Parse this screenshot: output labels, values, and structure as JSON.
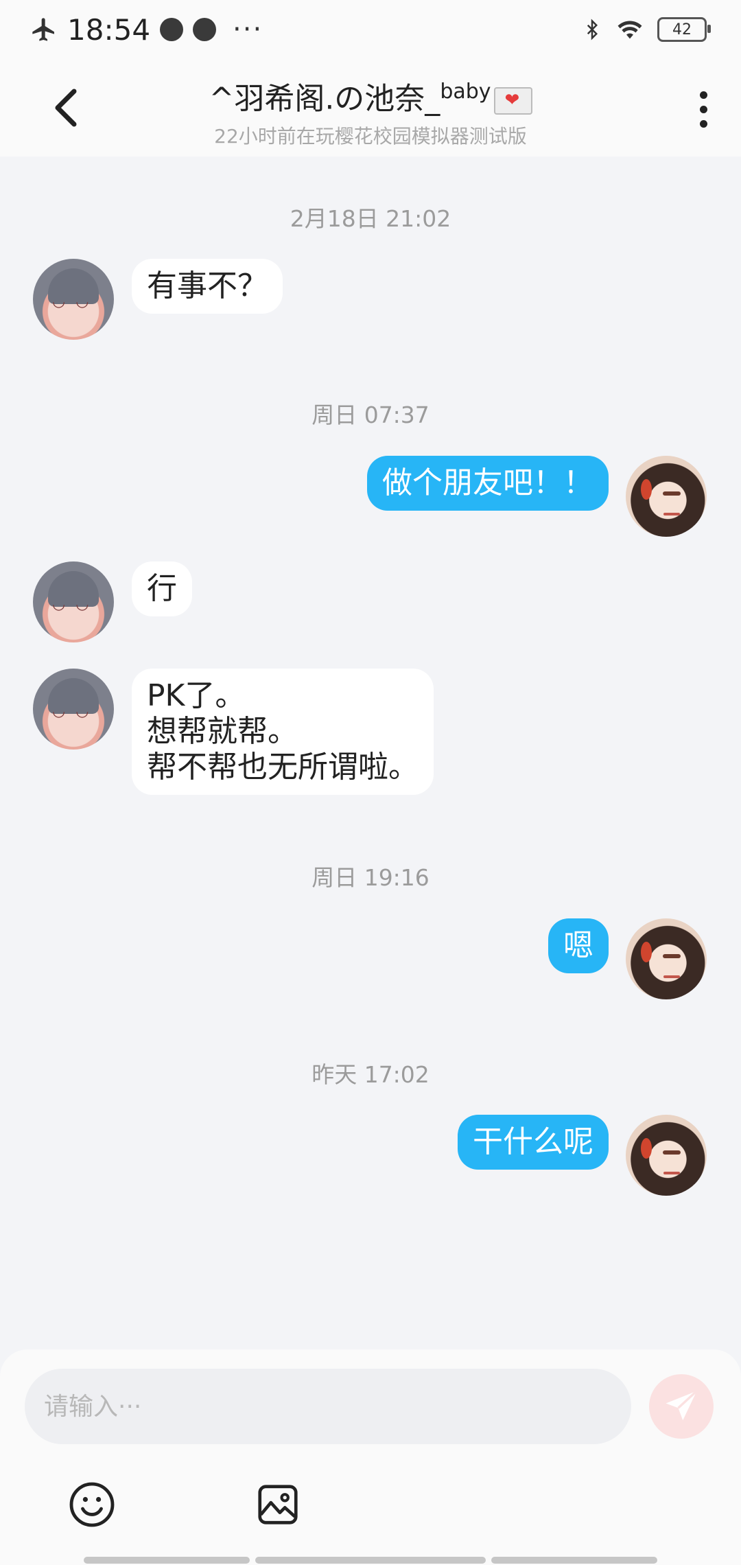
{
  "status_bar": {
    "time": "18:54",
    "more": "···",
    "battery": "42",
    "icons": [
      "airplane-icon",
      "voice-app-icon",
      "planet-app-icon",
      "bluetooth-icon",
      "wifi-icon",
      "battery-icon"
    ]
  },
  "header": {
    "title_main": "^羽希阁.の池奈_",
    "title_sup": "baby",
    "title_emoji": "love-letter-icon",
    "subtitle": "22小时前在玩樱花校园模拟器测试版"
  },
  "chat": {
    "timestamps": [
      "2月18日 21:02",
      "周日 07:37",
      "周日 19:16",
      "昨天 17:02"
    ],
    "messages": [
      {
        "side": "left",
        "text": "有事不？"
      },
      {
        "side": "right",
        "text": "做个朋友吧！！"
      },
      {
        "side": "left",
        "text": "行"
      },
      {
        "side": "left",
        "text": "PK了。\n想帮就帮。\n帮不帮也无所谓啦。"
      },
      {
        "side": "right",
        "text": "嗯"
      },
      {
        "side": "right",
        "text": "干什么呢"
      }
    ]
  },
  "composer": {
    "placeholder": "请输入···",
    "send_color": "#fbe1e1"
  },
  "colors": {
    "outgoing_bubble": "#27b5f6",
    "incoming_bubble": "#ffffff",
    "background": "#f3f4f7"
  }
}
